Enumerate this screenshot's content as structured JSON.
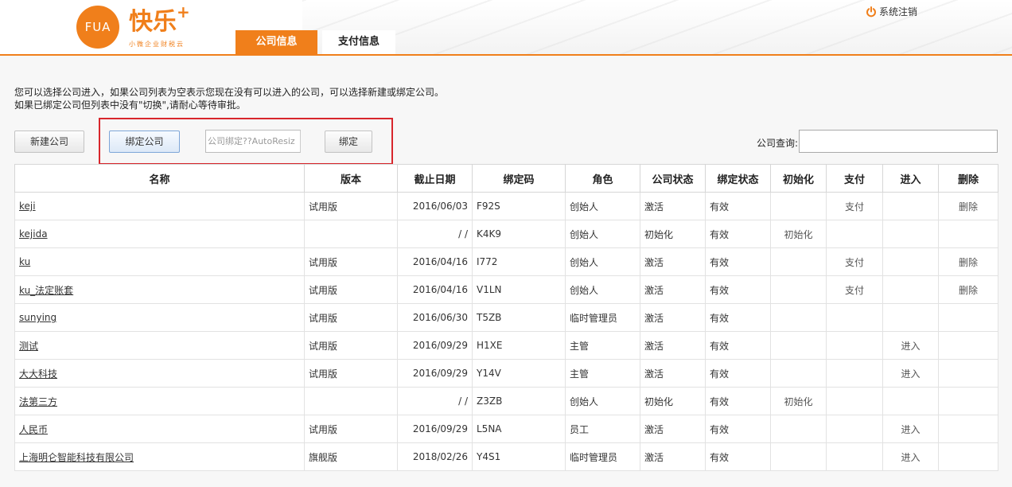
{
  "header": {
    "logo_mark": "FUA",
    "logo_title": "快乐",
    "logo_plus": "+",
    "logo_subtitle": "小微企业财税云",
    "tabs": [
      {
        "label": "公司信息",
        "active": true
      },
      {
        "label": "支付信息",
        "active": false
      }
    ],
    "logout_label": "系统注销",
    "accent_color": "#f07f1b"
  },
  "info": {
    "line1": "您可以选择公司进入，如果公司列表为空表示您现在没有可以进入的公司，可以选择新建或绑定公司。",
    "line2": "如果已绑定公司但列表中没有\"切换\",请耐心等待审批。"
  },
  "toolbar": {
    "new_company_label": "新建公司",
    "bind_company_label": "绑定公司",
    "bind_input_placeholder": "公司绑定??AutoResiz",
    "bind_confirm_label": "绑定",
    "search_label": "公司查询:",
    "search_value": "",
    "highlight_color": "#d8262c"
  },
  "table": {
    "headers": [
      "名称",
      "版本",
      "截止日期",
      "绑定码",
      "角色",
      "公司状态",
      "绑定状态",
      "初始化",
      "支付",
      "进入",
      "删除"
    ],
    "rows": [
      {
        "name": "keji",
        "version": "试用版",
        "deadline": "2016/06/03",
        "code": "F92S",
        "role": "创始人",
        "status": "激活",
        "bind": "有效",
        "init": "",
        "pay": "支付",
        "enter": "",
        "delete": "删除"
      },
      {
        "name": "kejida",
        "version": "",
        "deadline": "/ /",
        "code": "K4K9",
        "role": "创始人",
        "status": "初始化",
        "bind": "有效",
        "init": "初始化",
        "pay": "",
        "enter": "",
        "delete": ""
      },
      {
        "name": "ku",
        "version": "试用版",
        "deadline": "2016/04/16",
        "code": "I772",
        "role": "创始人",
        "status": "激活",
        "bind": "有效",
        "init": "",
        "pay": "支付",
        "enter": "",
        "delete": "删除"
      },
      {
        "name": "ku_法定账套",
        "version": "试用版",
        "deadline": "2016/04/16",
        "code": "V1LN",
        "role": "创始人",
        "status": "激活",
        "bind": "有效",
        "init": "",
        "pay": "支付",
        "enter": "",
        "delete": "删除"
      },
      {
        "name": "sunying",
        "version": "试用版",
        "deadline": "2016/06/30",
        "code": "T5ZB",
        "role": "临时管理员",
        "status": "激活",
        "bind": "有效",
        "init": "",
        "pay": "",
        "enter": "",
        "delete": ""
      },
      {
        "name": "测试",
        "version": "试用版",
        "deadline": "2016/09/29",
        "code": "H1XE",
        "role": "主管",
        "status": "激活",
        "bind": "有效",
        "init": "",
        "pay": "",
        "enter": "进入",
        "delete": ""
      },
      {
        "name": "大大科技",
        "version": "试用版",
        "deadline": "2016/09/29",
        "code": "Y14V",
        "role": "主管",
        "status": "激活",
        "bind": "有效",
        "init": "",
        "pay": "",
        "enter": "进入",
        "delete": ""
      },
      {
        "name": "法第三方",
        "version": "",
        "deadline": "/ /",
        "code": "Z3ZB",
        "role": "创始人",
        "status": "初始化",
        "bind": "有效",
        "init": "初始化",
        "pay": "",
        "enter": "",
        "delete": ""
      },
      {
        "name": "人民币",
        "version": "试用版",
        "deadline": "2016/09/29",
        "code": "L5NA",
        "role": "员工",
        "status": "激活",
        "bind": "有效",
        "init": "",
        "pay": "",
        "enter": "进入",
        "delete": ""
      },
      {
        "name": "上海明仑智能科技有限公司",
        "version": "旗舰版",
        "deadline": "2018/02/26",
        "code": "Y4S1",
        "role": "临时管理员",
        "status": "激活",
        "bind": "有效",
        "init": "",
        "pay": "",
        "enter": "进入",
        "delete": ""
      }
    ]
  }
}
